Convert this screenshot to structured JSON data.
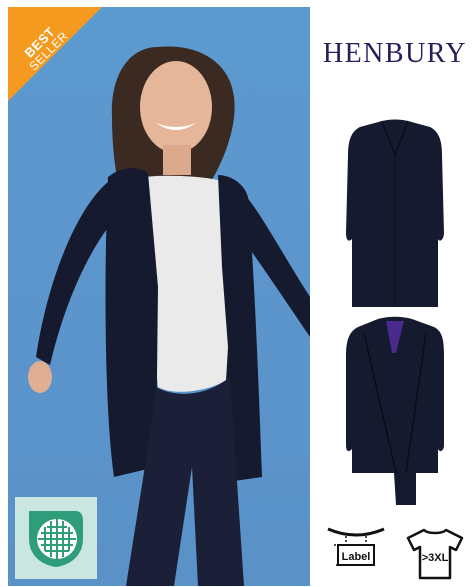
{
  "badge": {
    "line1": "BEST",
    "line2": "SELLER"
  },
  "brand": {
    "name": "HENBURY"
  },
  "icons": {
    "feature_icon": "cross-hatch-shield-icon",
    "label_icon": "removable-label-icon",
    "label_text": "Label",
    "size_icon": "tshirt-size-icon",
    "size_text": ">3XL"
  },
  "colors": {
    "badge_orange": "#f39a1f",
    "brand_purple": "#2a1e58",
    "hero_blue": "#5b9ad0",
    "garment_navy": "#151a2e",
    "feature_green": "#2f9c7a"
  }
}
